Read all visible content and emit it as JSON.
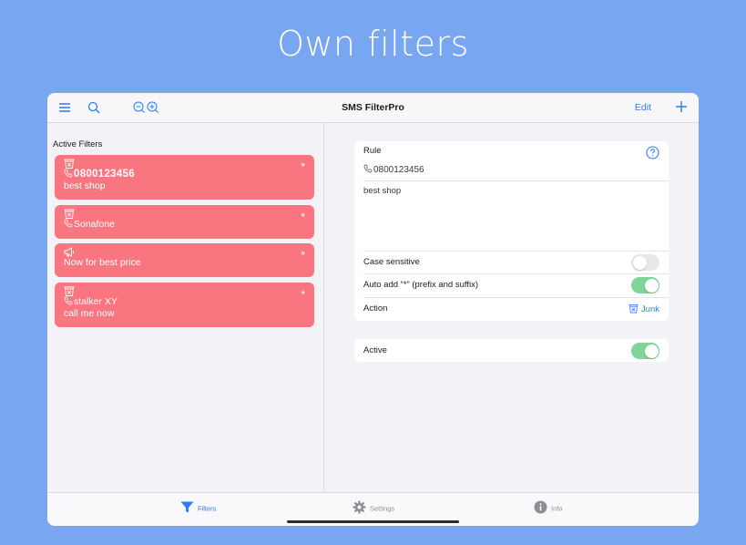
{
  "headline": "Own filters",
  "navbar": {
    "title": "SMS FilterPro",
    "edit_label": "Edit"
  },
  "left": {
    "section_label": "Active Filters",
    "filters": [
      {
        "icon": "junk-bin-icon",
        "number": "0800123456",
        "text": "best shop",
        "flag": "*"
      },
      {
        "icon": "junk-bin-icon",
        "number": "Sonafone",
        "text": "",
        "flag": "*"
      },
      {
        "icon": "megaphone-icon",
        "number": "",
        "text": "Now for best price",
        "flag": "*"
      },
      {
        "icon": "junk-bin-icon",
        "number": "stalker XY",
        "text": "call me now",
        "flag": "*"
      }
    ]
  },
  "detail": {
    "rule_label": "Rule",
    "rule_number": "0800123456",
    "rule_text": "best shop",
    "case_sensitive_label": "Case sensitive",
    "case_sensitive_on": false,
    "auto_add_label": "Auto add “*” (prefix and suffix)",
    "auto_add_on": true,
    "action_label": "Action",
    "action_value": "Junk",
    "active_label": "Active",
    "active_on": true
  },
  "tabs": [
    {
      "label": "Filters",
      "icon": "filter-funnel-icon",
      "selected": true
    },
    {
      "label": "Settings",
      "icon": "gear-icon",
      "selected": false
    },
    {
      "label": "Info",
      "icon": "info-icon",
      "selected": false
    }
  ],
  "colors": {
    "background": "#79a6f0",
    "accent": "#2e7cf6",
    "filter_card": "#f9757f",
    "toggle_on": "#7fd59a"
  }
}
